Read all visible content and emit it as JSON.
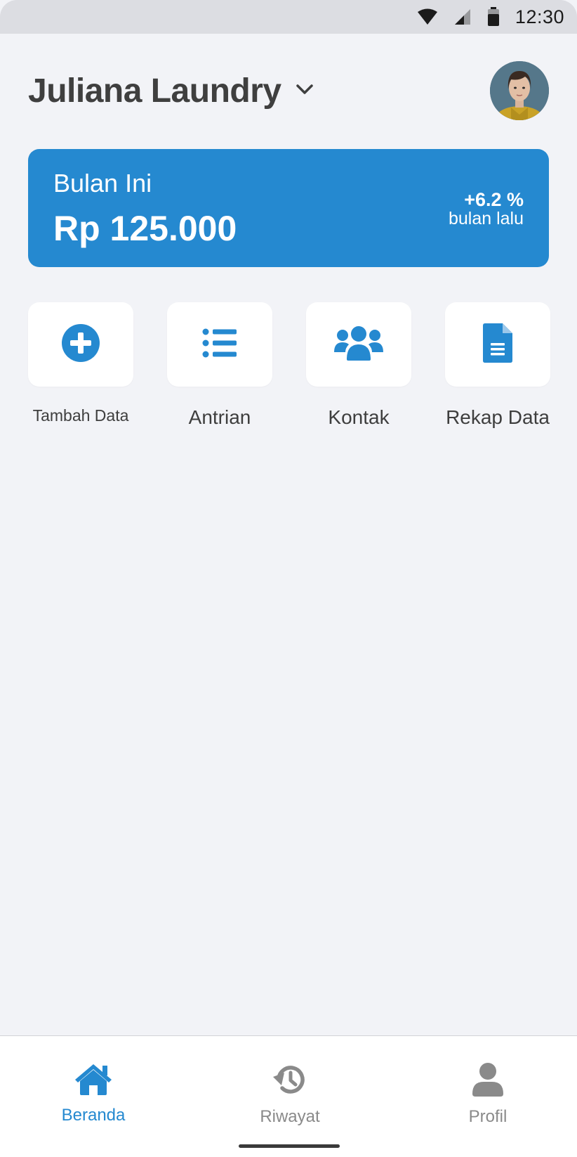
{
  "status_bar": {
    "time": "12:30",
    "icons": [
      "wifi-icon",
      "cellular-signal-icon",
      "battery-icon"
    ]
  },
  "header": {
    "store_name": "Juliana Laundry",
    "dropdown_icon": "chevron-down-icon",
    "avatar": "user-avatar"
  },
  "summary": {
    "period": "Bulan Ini",
    "amount": "Rp 125.000",
    "growth_value": "+6.2 %",
    "growth_label": "bulan lalu"
  },
  "menu": {
    "items": [
      {
        "label": "Tambah Data",
        "icon": "plus-circle-icon"
      },
      {
        "label": "Antrian",
        "icon": "list-icon"
      },
      {
        "label": "Kontak",
        "icon": "users-icon"
      },
      {
        "label": "Rekap Data",
        "icon": "document-icon"
      }
    ]
  },
  "nav": {
    "items": [
      {
        "label": "Beranda",
        "icon": "home-icon",
        "active": true
      },
      {
        "label": "Riwayat",
        "icon": "history-icon",
        "active": false
      },
      {
        "label": "Profil",
        "icon": "user-icon",
        "active": false
      }
    ]
  },
  "colors": {
    "primary": "#2589d0",
    "background": "#f2f3f7",
    "status_bar": "#dcdde2",
    "text_dark": "#3f3f3f",
    "nav_inactive": "#8a8a8a"
  }
}
